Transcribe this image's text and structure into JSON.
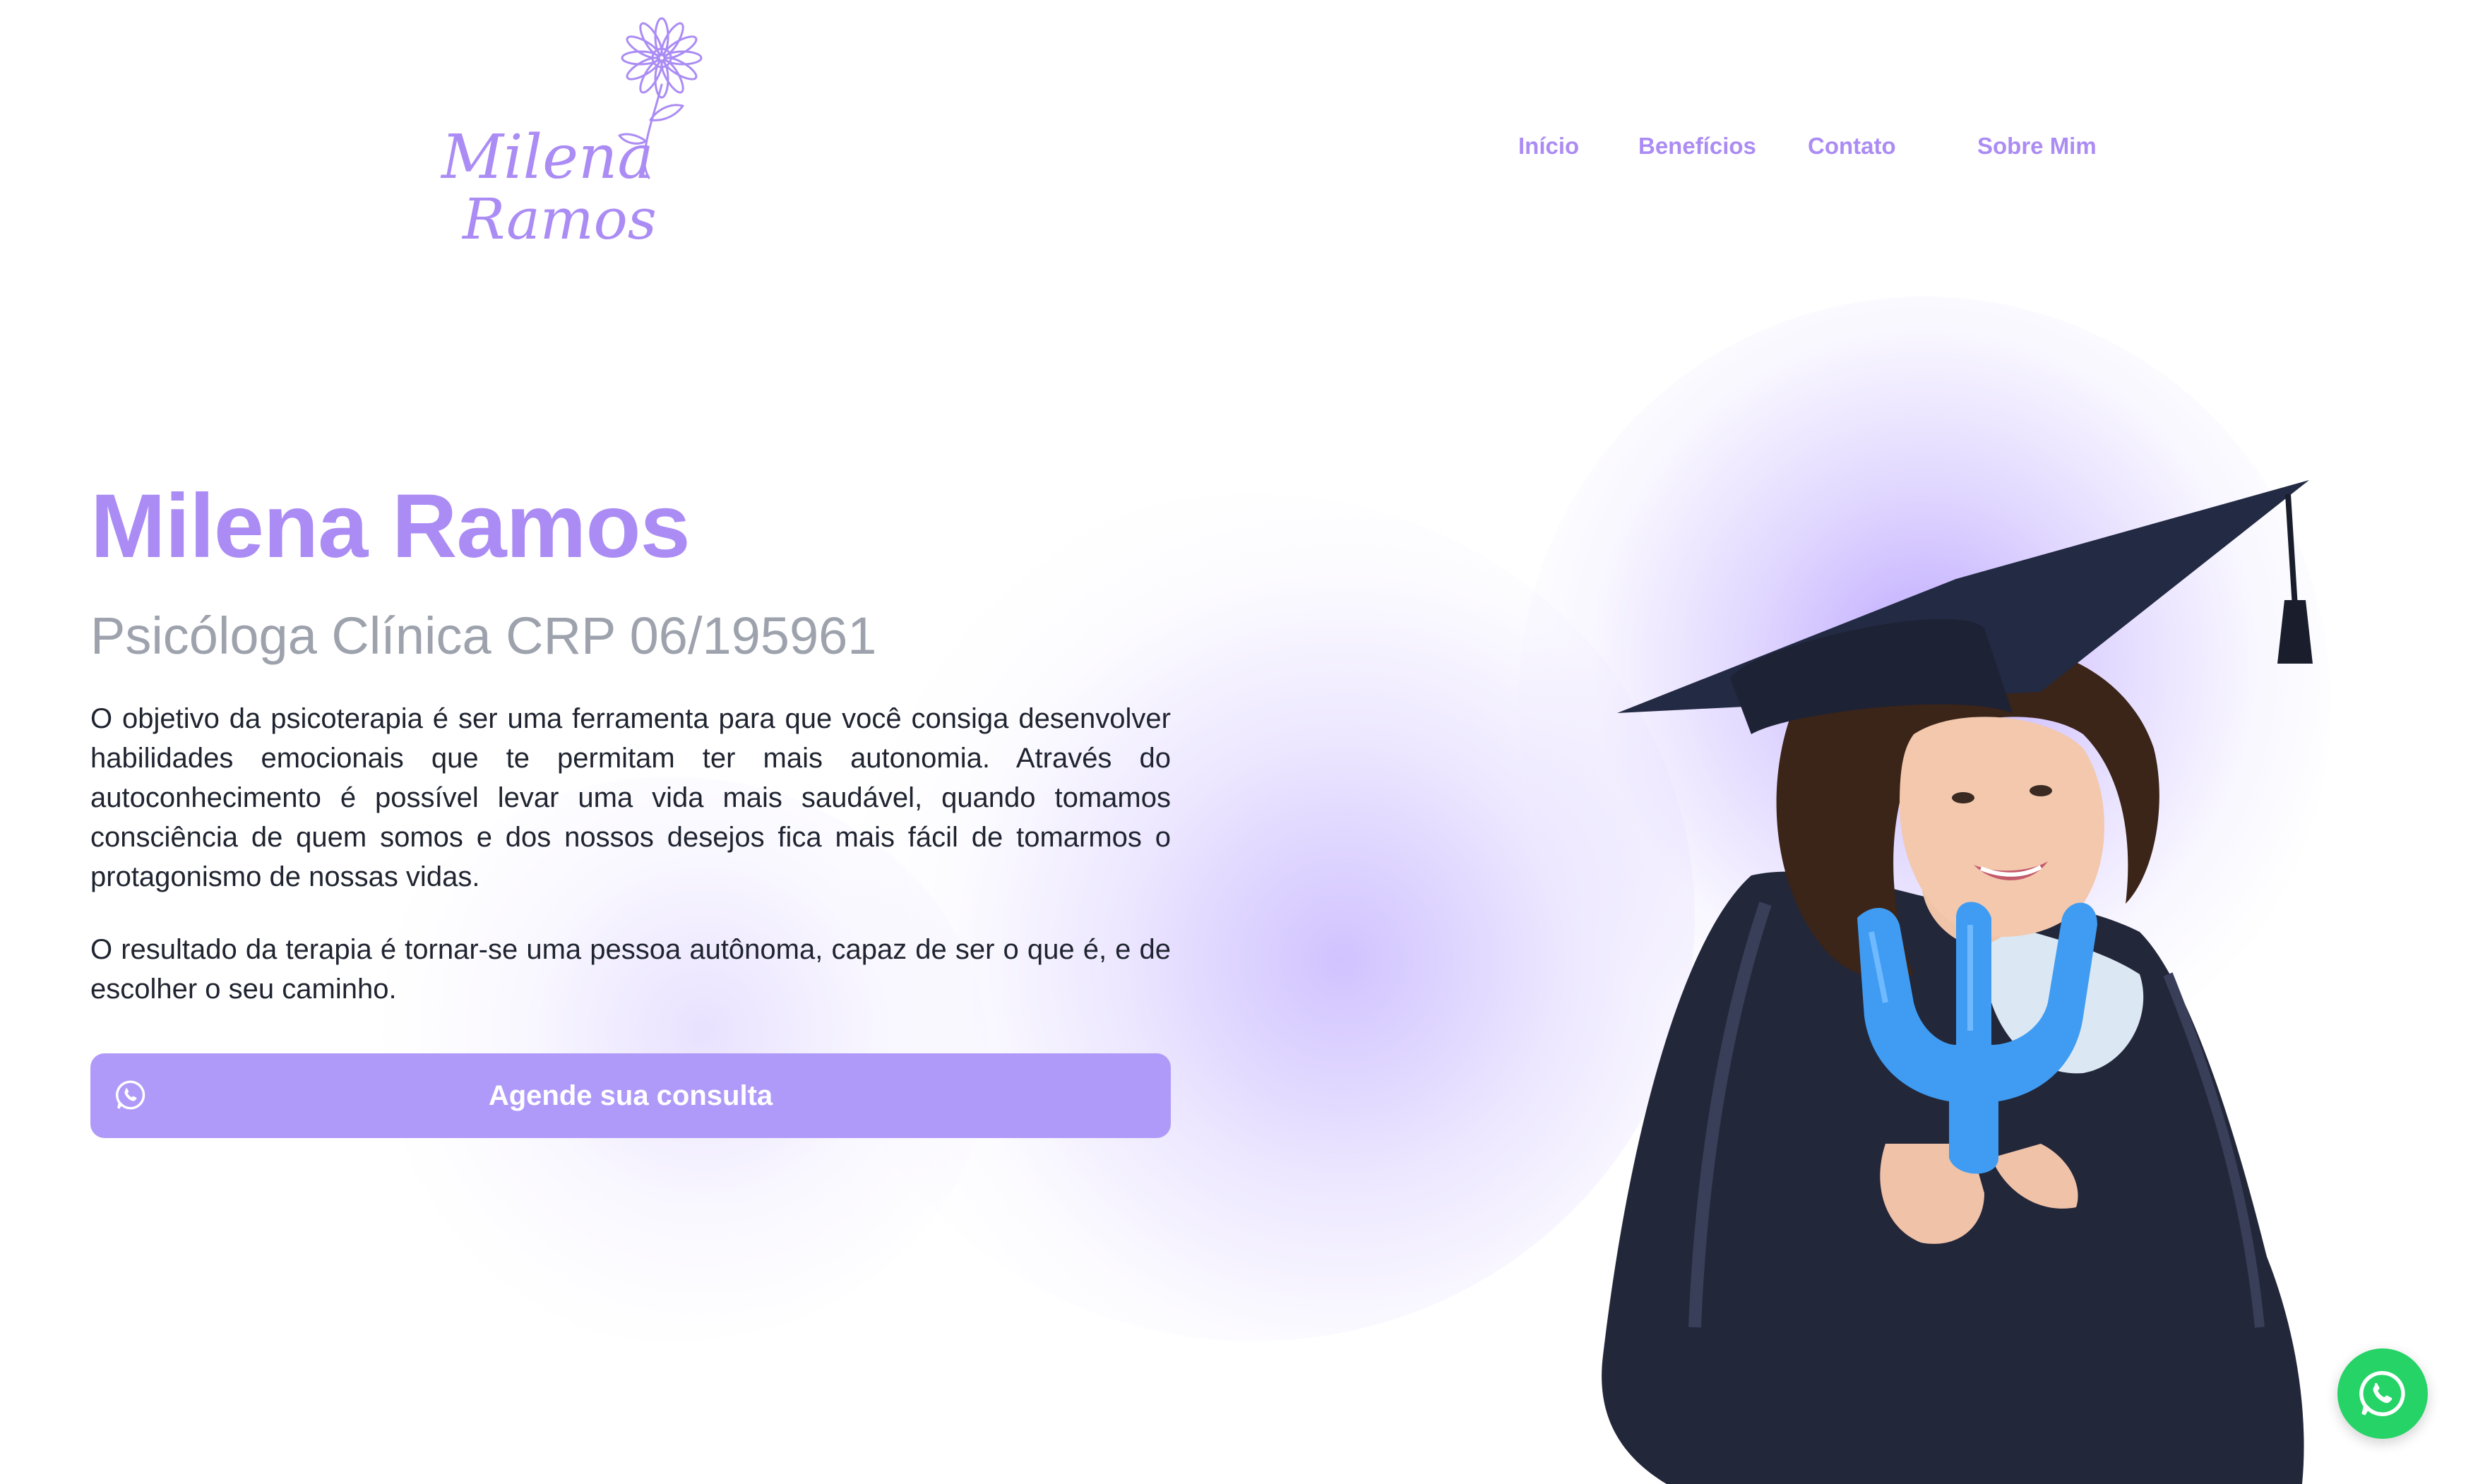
{
  "logo": {
    "line1": "Milena",
    "line2": "Ramos",
    "color": "#ab8cf4"
  },
  "nav": {
    "items": [
      {
        "label": "Início"
      },
      {
        "label": "Benefícios"
      },
      {
        "label": "Contato"
      },
      {
        "label": "Sobre Mim"
      }
    ]
  },
  "hero": {
    "title": "Milena Ramos",
    "subtitle": "Psicóloga Clínica CRP 06/195961",
    "paragraph1": "O objetivo da psicoterapia é ser uma ferramenta para que você consiga desenvolver habilidades emocionais que te permitam ter mais autonomia. Através do autoconhecimento é possível levar uma vida mais saudável, quando tomamos consciência de quem somos e dos nossos desejos fica mais fácil de tomarmos o protagonismo de nossas vidas.",
    "paragraph2": "O resultado da terapia é tornar-se uma pessoa autônoma, capaz de ser o que é, e de escolher o seu caminho.",
    "cta_label": "Agende sua consulta",
    "cta_icon": "whatsapp-icon"
  },
  "colors": {
    "accent": "#ab8cf4",
    "button": "#b09af9",
    "subtitle": "#9da2ad",
    "body_text": "#1f2430",
    "whatsapp": "#25d366"
  },
  "floating_button": {
    "icon": "whatsapp-icon"
  }
}
